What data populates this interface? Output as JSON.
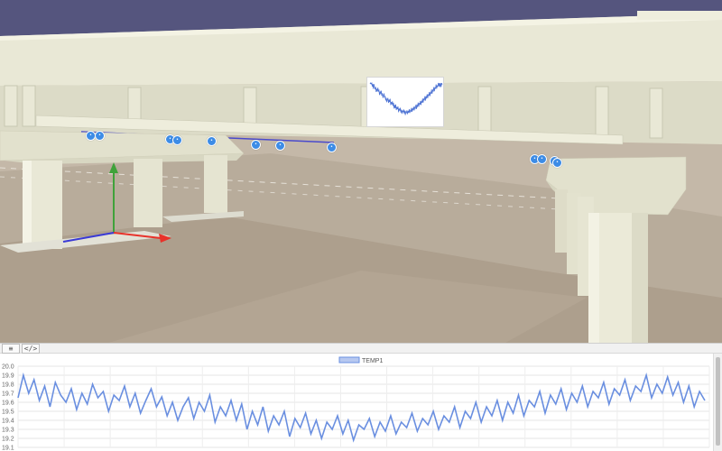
{
  "scene": {
    "sensors": [
      {
        "name": "sensor-1",
        "glyph": "((•))"
      },
      {
        "name": "sensor-2",
        "glyph": "((•))"
      },
      {
        "name": "sensor-3",
        "glyph": "((•))"
      },
      {
        "name": "sensor-4",
        "glyph": "((•))"
      },
      {
        "name": "sensor-5",
        "glyph": "((•))"
      },
      {
        "name": "sensor-6",
        "glyph": "((•))"
      },
      {
        "name": "sensor-7",
        "glyph": "((•))"
      },
      {
        "name": "sensor-8",
        "glyph": "((•))"
      },
      {
        "name": "sensor-9",
        "glyph": "((•))"
      },
      {
        "name": "sensor-10",
        "glyph": "((•))"
      },
      {
        "name": "sensor-11",
        "glyph": "((•))"
      },
      {
        "name": "sensor-12",
        "glyph": "((•))"
      }
    ],
    "gizmo": {
      "x_color": "#e8322a",
      "y_color": "#3fa23a",
      "z_color": "#3a3ad6"
    }
  },
  "tabs": [
    {
      "name": "tab-document",
      "glyph": "≡"
    },
    {
      "name": "tab-code",
      "glyph": "</>"
    }
  ],
  "chart_data": {
    "type": "line",
    "series": [
      {
        "name": "TEMP1",
        "color": "#6a8fe0",
        "values": [
          19.65,
          19.9,
          19.7,
          19.85,
          19.62,
          19.78,
          19.55,
          19.82,
          19.68,
          19.6,
          19.75,
          19.52,
          19.7,
          19.58,
          19.8,
          19.65,
          19.72,
          19.5,
          19.68,
          19.62,
          19.78,
          19.55,
          19.7,
          19.48,
          19.62,
          19.75,
          19.55,
          19.66,
          19.45,
          19.6,
          19.4,
          19.55,
          19.65,
          19.42,
          19.6,
          19.5,
          19.68,
          19.38,
          19.55,
          19.45,
          19.62,
          19.4,
          19.58,
          19.3,
          19.5,
          19.35,
          19.55,
          19.28,
          19.45,
          19.35,
          19.5,
          19.22,
          19.42,
          19.32,
          19.48,
          19.25,
          19.4,
          19.2,
          19.38,
          19.3,
          19.45,
          19.25,
          19.4,
          19.18,
          19.35,
          19.3,
          19.42,
          19.22,
          19.38,
          19.28,
          19.45,
          19.25,
          19.38,
          19.32,
          19.48,
          19.28,
          19.42,
          19.35,
          19.5,
          19.3,
          19.45,
          19.38,
          19.55,
          19.32,
          19.5,
          19.42,
          19.6,
          19.38,
          19.55,
          19.45,
          19.62,
          19.4,
          19.6,
          19.48,
          19.68,
          19.45,
          19.62,
          19.55,
          19.72,
          19.48,
          19.68,
          19.58,
          19.75,
          19.52,
          19.7,
          19.6,
          19.78,
          19.55,
          19.72,
          19.65,
          19.82,
          19.58,
          19.75,
          19.68,
          19.85,
          19.62,
          19.78,
          19.72,
          19.9,
          19.65,
          19.8,
          19.7,
          19.88,
          19.68,
          19.82,
          19.6,
          19.78,
          19.55,
          19.72,
          19.62
        ]
      }
    ],
    "title": "",
    "ylim": [
      19.1,
      20.0
    ],
    "yticks": [
      "20.0",
      "19.9",
      "19.8",
      "19.7",
      "19.6",
      "19.5",
      "19.4",
      "19.3",
      "19.2",
      "19.1"
    ],
    "grid": true,
    "legend": "top-center"
  }
}
